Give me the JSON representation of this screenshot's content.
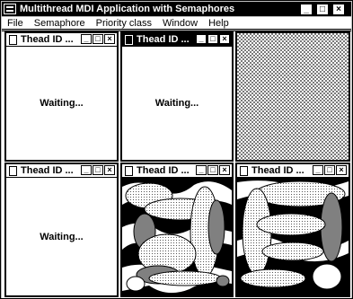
{
  "app": {
    "title": "Multithread MDI Application with Semaphores",
    "controls": {
      "minimize": "_",
      "maximize": "□",
      "close": "×"
    }
  },
  "menu": [
    "File",
    "Semaphore",
    "Priority class",
    "Window",
    "Help"
  ],
  "children": [
    {
      "title": "Thead ID ...",
      "status": "Waiting...",
      "active": false
    },
    {
      "title": "Thead ID ...",
      "status": "Waiting...",
      "active": true
    },
    {
      "title": "Thead ID ...",
      "status": "Waiting...",
      "active": false
    },
    {
      "title": "Thead ID ...",
      "status": "",
      "active": false
    },
    {
      "title": "Thead ID ...",
      "status": "",
      "active": false
    }
  ],
  "child_controls": {
    "minimize": "_",
    "maximize": "□",
    "close": "×"
  },
  "colors": {
    "titlebar": "#000000",
    "pattern": "#7a7a7a",
    "shape_gray": "#808080"
  }
}
